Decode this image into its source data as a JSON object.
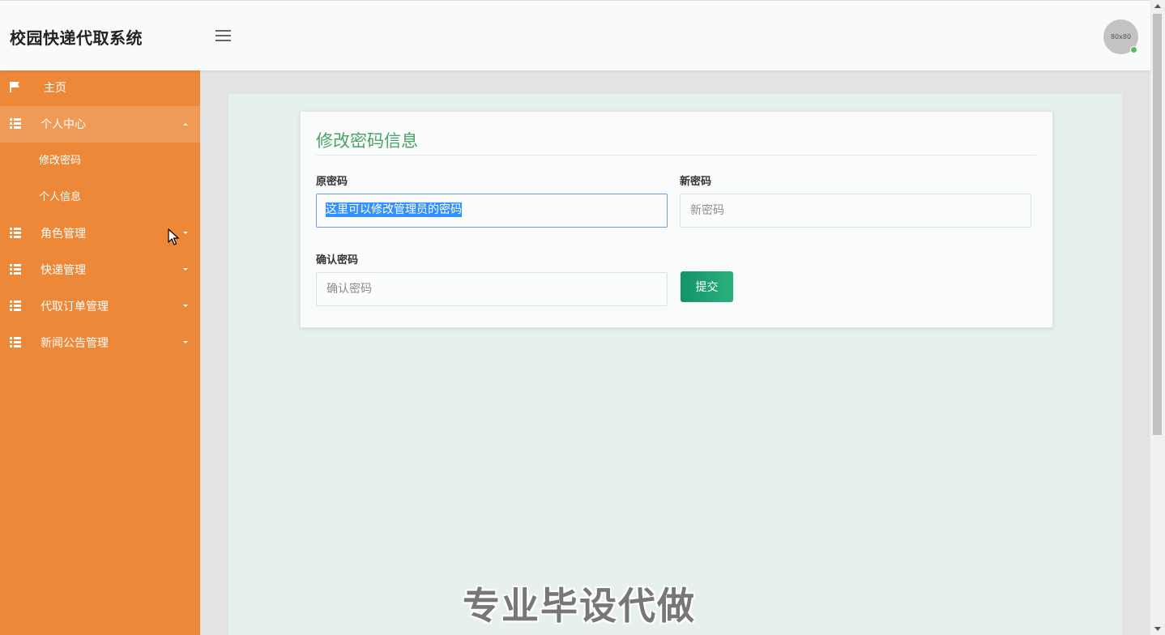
{
  "header": {
    "app_title": "校园快递代取系统",
    "avatar_text": "80x80"
  },
  "sidebar": {
    "items": [
      {
        "label": "主页",
        "icon": "flag-icon"
      },
      {
        "label": "个人中心",
        "icon": "grid-icon",
        "expanded": true,
        "children": [
          {
            "label": "修改密码"
          },
          {
            "label": "个人信息"
          }
        ]
      },
      {
        "label": "角色管理",
        "icon": "grid-icon"
      },
      {
        "label": "快递管理",
        "icon": "grid-icon"
      },
      {
        "label": "代取订单管理",
        "icon": "grid-icon"
      },
      {
        "label": "新闻公告管理",
        "icon": "grid-icon"
      }
    ]
  },
  "form": {
    "title": "修改密码信息",
    "old_password_label": "原密码",
    "old_password_value": "这里可以修改管理员的密码",
    "new_password_label": "新密码",
    "new_password_placeholder": "新密码",
    "confirm_password_label": "确认密码",
    "confirm_password_placeholder": "确认密码",
    "submit_label": "提交"
  },
  "watermark": "专业毕设代做",
  "colors": {
    "sidebar": "#ec8838",
    "sidebar_active": "#ef9b57",
    "title_green": "#4aa26a",
    "button_green": "#13936a",
    "content_bg": "#e6f0ec"
  }
}
